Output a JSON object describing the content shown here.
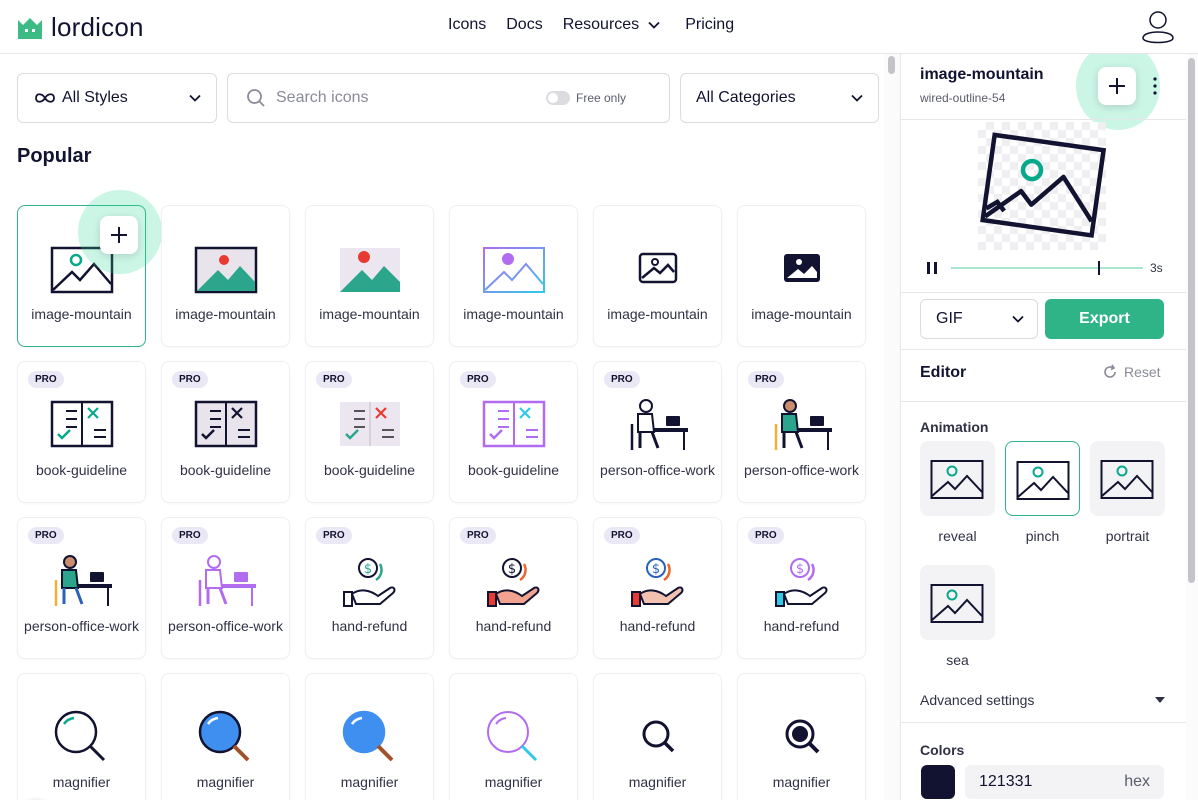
{
  "header": {
    "logo_text": "lordicon",
    "nav": [
      {
        "label": "Icons"
      },
      {
        "label": "Docs"
      },
      {
        "label": "Resources"
      },
      {
        "label": "Pricing"
      }
    ]
  },
  "filters": {
    "styles_label": "All Styles",
    "search_placeholder": "Search icons",
    "free_only_label": "Free only",
    "categories_label": "All Categories"
  },
  "section_title": "Popular",
  "pro_badge": "PRO",
  "cards": [
    {
      "label": "image-mountain",
      "pro": false,
      "icon": "image-mountain-wired-icon",
      "selected": true
    },
    {
      "label": "image-mountain",
      "pro": false,
      "icon": "image-mountain-flat-icon"
    },
    {
      "label": "image-mountain",
      "pro": false,
      "icon": "image-mountain-solid-color-icon"
    },
    {
      "label": "image-mountain",
      "pro": false,
      "icon": "image-mountain-gradient-icon"
    },
    {
      "label": "image-mountain",
      "pro": false,
      "icon": "image-mountain-outline-icon"
    },
    {
      "label": "image-mountain",
      "pro": false,
      "icon": "image-mountain-solid-icon"
    },
    {
      "label": "book-guideline",
      "pro": true,
      "icon": "book-guideline-icon"
    },
    {
      "label": "book-guideline",
      "pro": true,
      "icon": "book-guideline-icon"
    },
    {
      "label": "book-guideline",
      "pro": true,
      "icon": "book-guideline-icon"
    },
    {
      "label": "book-guideline",
      "pro": true,
      "icon": "book-guideline-icon"
    },
    {
      "label": "person-office-work",
      "pro": true,
      "icon": "person-office-work-icon"
    },
    {
      "label": "person-office-work",
      "pro": true,
      "icon": "person-office-work-icon"
    },
    {
      "label": "person-office-work",
      "pro": true,
      "icon": "person-office-work-icon"
    },
    {
      "label": "person-office-work",
      "pro": true,
      "icon": "person-office-work-icon"
    },
    {
      "label": "hand-refund",
      "pro": true,
      "icon": "hand-refund-icon"
    },
    {
      "label": "hand-refund",
      "pro": true,
      "icon": "hand-refund-icon"
    },
    {
      "label": "hand-refund",
      "pro": true,
      "icon": "hand-refund-icon"
    },
    {
      "label": "hand-refund",
      "pro": true,
      "icon": "hand-refund-icon"
    },
    {
      "label": "magnifier",
      "pro": false,
      "icon": "magnifier-icon"
    },
    {
      "label": "magnifier",
      "pro": false,
      "icon": "magnifier-icon"
    },
    {
      "label": "magnifier",
      "pro": false,
      "icon": "magnifier-icon"
    },
    {
      "label": "magnifier",
      "pro": false,
      "icon": "magnifier-icon"
    },
    {
      "label": "magnifier",
      "pro": false,
      "icon": "magnifier-icon"
    },
    {
      "label": "magnifier",
      "pro": false,
      "icon": "magnifier-icon"
    }
  ],
  "detail": {
    "title": "image-mountain",
    "subtitle": "wired-outline-54",
    "duration": "3s",
    "format": "GIF",
    "export_label": "Export",
    "editor_title": "Editor",
    "reset_label": "Reset",
    "animation_title": "Animation",
    "animations": [
      {
        "label": "reveal",
        "active": false
      },
      {
        "label": "pinch",
        "active": true
      },
      {
        "label": "portrait",
        "active": false
      },
      {
        "label": "sea",
        "active": false
      }
    ],
    "advanced_label": "Advanced settings",
    "colors_title": "Colors",
    "color_hex": "121331",
    "color_unit": "hex"
  },
  "colors": {
    "primary": "#121331",
    "accent": "#2fb487",
    "brand": "#3dbb84",
    "secondary": "#08a88a"
  }
}
